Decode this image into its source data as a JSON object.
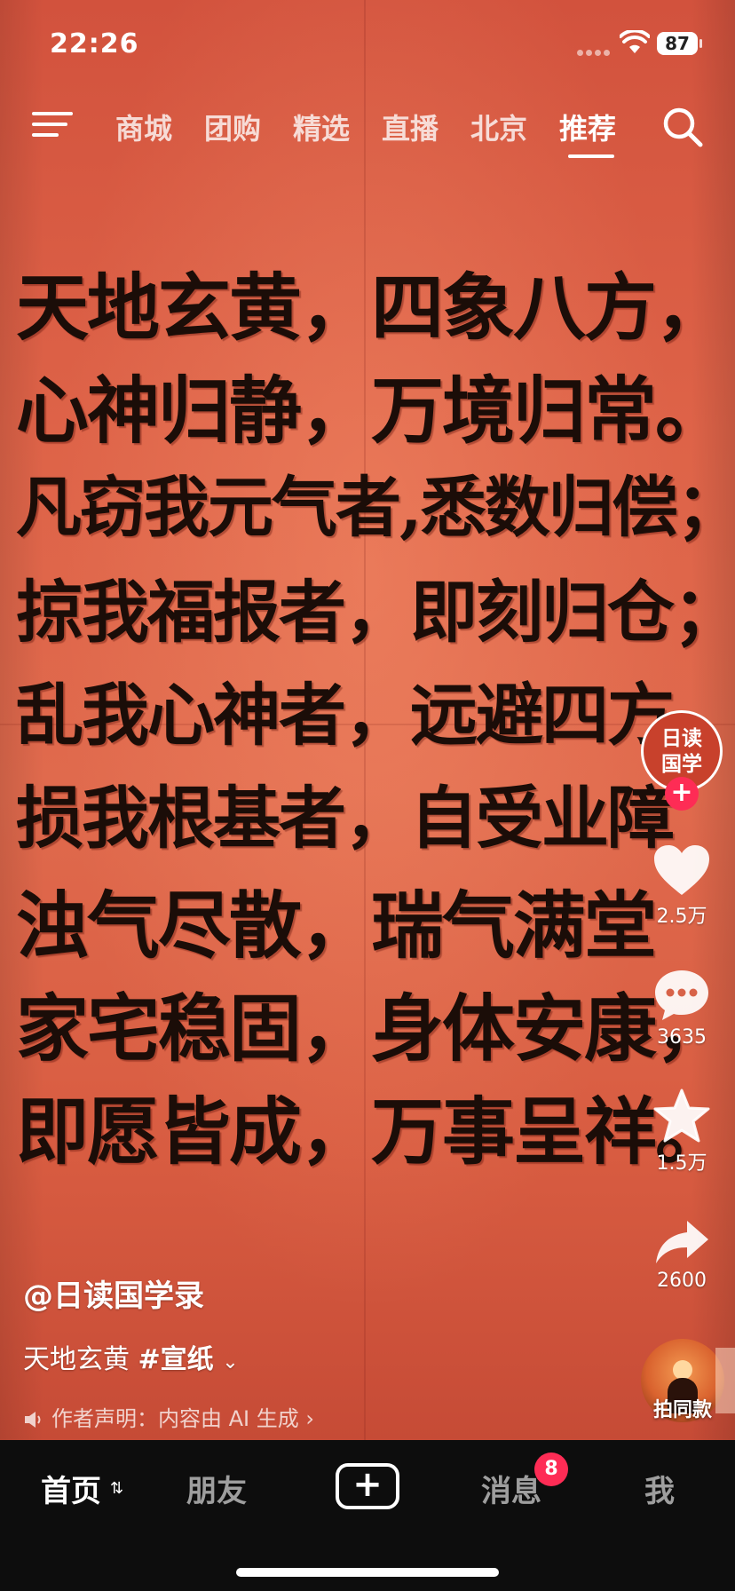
{
  "status_bar": {
    "time": "22:26",
    "battery": "87"
  },
  "top_nav": {
    "tabs": [
      "商城",
      "团购",
      "精选",
      "直播",
      "北京",
      "推荐"
    ],
    "active_tab": "推荐"
  },
  "poem": {
    "lines": [
      "天地玄黄，四象八方，",
      "心神归静，万境归常。",
      "凡窃我元气者,悉数归偿；",
      "掠我福报者，即刻归仓；",
      "乱我心神者，远避四方",
      "损我根基者，自受业障",
      "浊气尽散，瑞气满堂",
      "家宅稳固，身体安康，",
      "即愿皆成，万事呈祥。"
    ]
  },
  "sidebar": {
    "avatar_text_line1": "日读",
    "avatar_text_line2": "国学",
    "follow": "+",
    "likes": "2.5万",
    "comments": "3635",
    "favorites": "1.5万",
    "shares": "2600",
    "same_style": "拍同款"
  },
  "video_info": {
    "author": "@日读国学录",
    "desc_text": "天地玄黄 ",
    "hashtag": "#宣纸",
    "ai_note": "作者声明：内容由 AI 生成 ›"
  },
  "bottom_bar": {
    "home": "首页",
    "friends": "朋友",
    "plus": "+",
    "messages": "消息",
    "messages_badge": "8",
    "me": "我"
  },
  "colors": {
    "paper_red": "#de6348",
    "badge_red": "#fe2c55",
    "tabbar_bg": "#0d0d0d"
  }
}
